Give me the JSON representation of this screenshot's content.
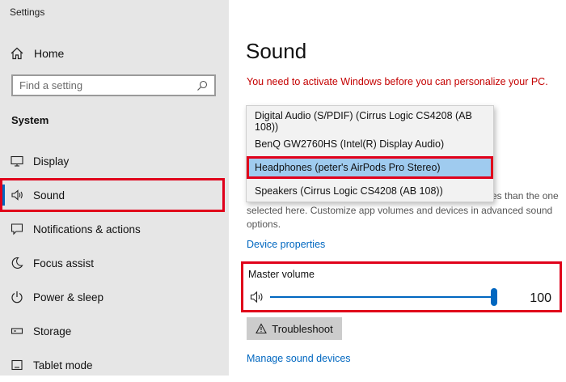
{
  "app": {
    "title": "Settings"
  },
  "sidebar": {
    "home_label": "Home",
    "search_placeholder": "Find a setting",
    "section_title": "System",
    "items": [
      {
        "label": "Display",
        "icon": "monitor-icon"
      },
      {
        "label": "Sound",
        "icon": "speaker-icon",
        "selected": true
      },
      {
        "label": "Notifications & actions",
        "icon": "notification-icon"
      },
      {
        "label": "Focus assist",
        "icon": "moon-icon"
      },
      {
        "label": "Power & sleep",
        "icon": "power-icon"
      },
      {
        "label": "Storage",
        "icon": "storage-icon"
      },
      {
        "label": "Tablet mode",
        "icon": "tablet-icon"
      }
    ]
  },
  "main": {
    "title": "Sound",
    "activation_message": "You need to activate Windows before you can personalize your PC.",
    "background_text": {
      "line1": "es than the one",
      "line2": "selected here. Customize app volumes and devices in advanced sound",
      "line3": "options."
    },
    "device_properties_link": "Device properties",
    "master_volume": {
      "label": "Master volume",
      "value": "100",
      "level": 1.0
    },
    "troubleshoot_label": "Troubleshoot",
    "manage_devices_link": "Manage sound devices"
  },
  "output_dropdown": {
    "options": [
      "Digital Audio (S/PDIF) (Cirrus Logic CS4208 (AB 108))",
      "BenQ GW2760HS (Intel(R) Display Audio)",
      "Headphones (peter's AirPods Pro Stereo)",
      "Speakers (Cirrus Logic CS4208 (AB 108))"
    ],
    "selected_index": 2
  },
  "colors": {
    "accent": "#0067c0",
    "highlight_border": "#e0001b",
    "warning_text": "#c40000",
    "selected_option_bg": "#9fcbef"
  }
}
